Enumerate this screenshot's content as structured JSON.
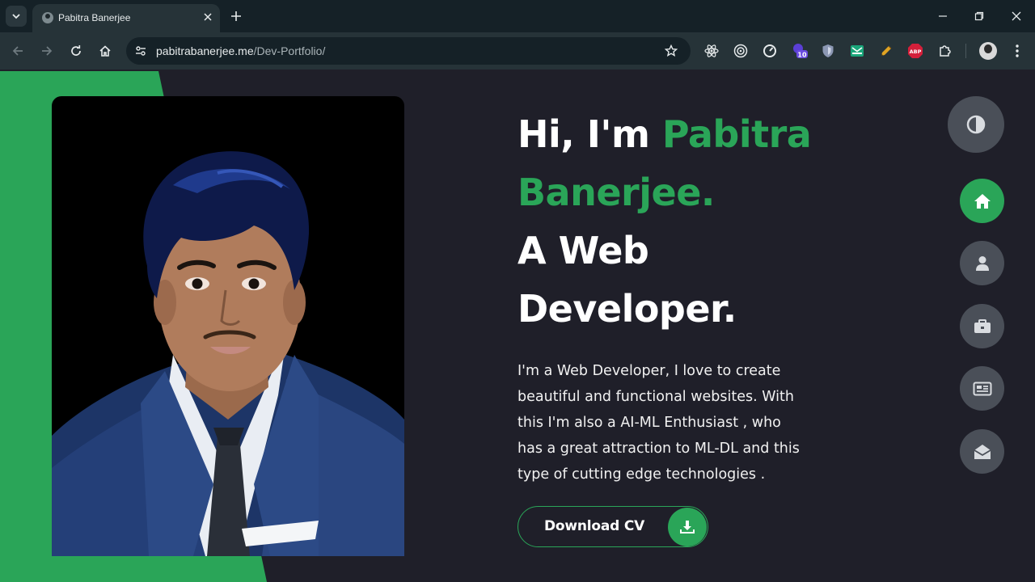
{
  "browser": {
    "tab_title": "Pabitra Banerjee",
    "url_host": "pabitrabanerjee.me",
    "url_path": "/Dev-Portfolio/",
    "extension_badge": "10",
    "abp_label": "ABP"
  },
  "hero": {
    "greeting": "Hi, I'm ",
    "name_line1": "Pabitra",
    "name_line2": "Banerjee.",
    "role_line1": "A Web",
    "role_line2": "Developer.",
    "intro": "I'm a Web Developer, I love to create beautiful and functional websites. With this I'm also a AI-ML Enthusiast , who has a great attraction to ML-DL and this type of cutting edge technologies .",
    "cv_button": "Download CV"
  },
  "side_nav": {
    "items": [
      {
        "icon": "home-icon",
        "active": true
      },
      {
        "icon": "user-icon",
        "active": false
      },
      {
        "icon": "briefcase-icon",
        "active": false
      },
      {
        "icon": "newspaper-icon",
        "active": false
      },
      {
        "icon": "envelope-open-icon",
        "active": false
      }
    ],
    "theme_toggle_icon": "contrast-icon"
  },
  "colors": {
    "accent": "#2aa558",
    "page_bg": "#1f1f29",
    "button_bg": "#4a4f58"
  }
}
